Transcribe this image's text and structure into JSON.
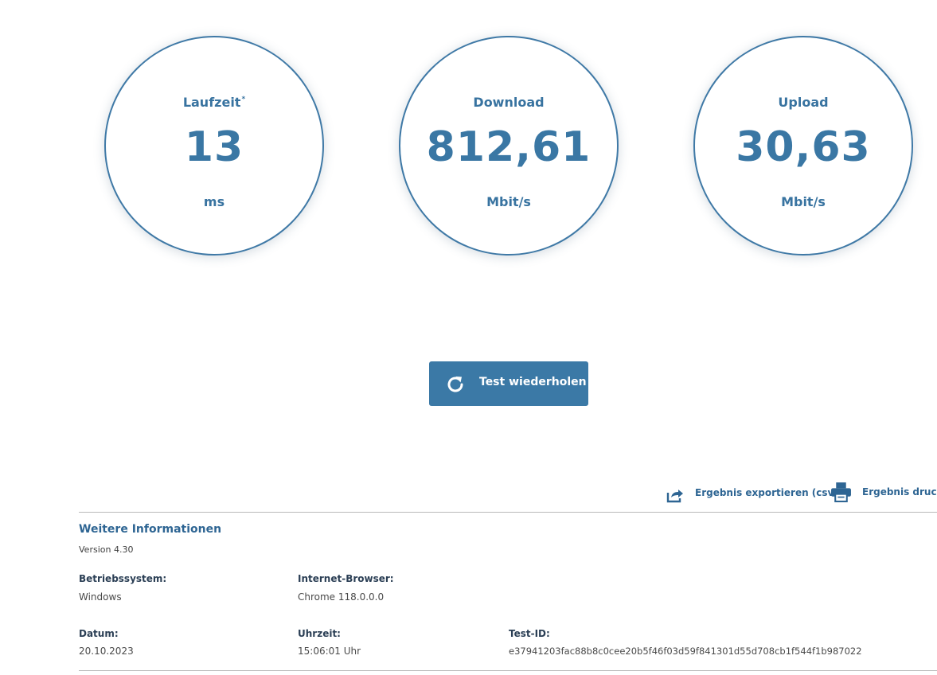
{
  "gauges": {
    "latency": {
      "label": "Laufzeit",
      "marker": "*",
      "value": "13",
      "unit": "ms"
    },
    "download": {
      "label": "Download",
      "value": "812,61",
      "unit": "Mbit/s"
    },
    "upload": {
      "label": "Upload",
      "value": "30,63",
      "unit": "Mbit/s"
    }
  },
  "retest_button": {
    "label": "Test wiederholen",
    "icon": "refresh-icon"
  },
  "actions": {
    "export": {
      "label": "Ergebnis exportieren (csv)",
      "icon": "share-export-icon"
    },
    "print": {
      "label": "Ergebnis drucken",
      "icon": "printer-icon"
    }
  },
  "info": {
    "title": "Weitere Informationen",
    "version": "Version 4.30",
    "os": {
      "label": "Betriebssystem:",
      "value": "Windows"
    },
    "browser": {
      "label": "Internet-Browser:",
      "value": "Chrome 118.0.0.0"
    },
    "date": {
      "label": "Datum:",
      "value": "20.10.2023"
    },
    "time": {
      "label": "Uhrzeit:",
      "value": "15:06:01 Uhr"
    },
    "test_id": {
      "label": "Test-ID:",
      "value": "e37941203fac88b8c0cee20b5f46f03d59f841301d55d708cb1f544f1b987022"
    }
  },
  "colors": {
    "accent": "#3b79a6",
    "heading": "#2e6593",
    "divider": "#b9b9b9"
  }
}
